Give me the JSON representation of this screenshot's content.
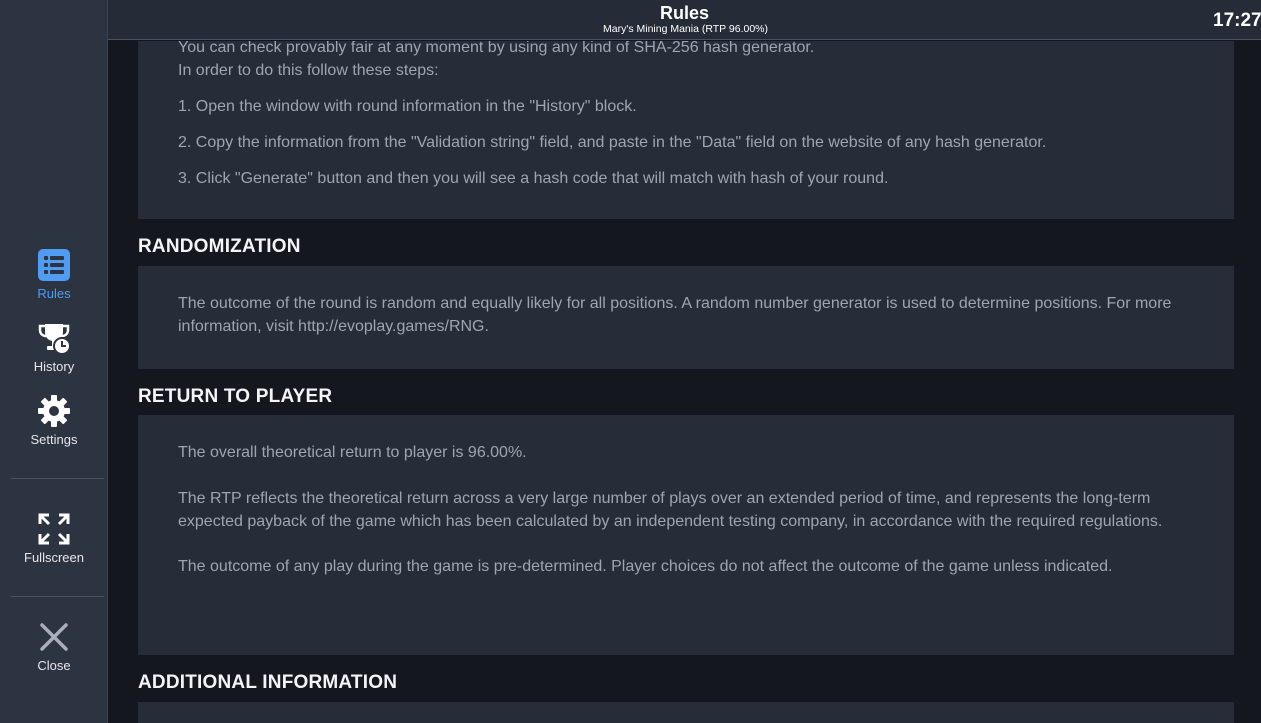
{
  "header": {
    "title": "Rules",
    "subtitle": "Mary's Mining Mania (RTP 96.00%)",
    "clock": "17:27"
  },
  "sidebar": {
    "items": [
      {
        "label": "Rules",
        "icon": "list-icon",
        "active": true
      },
      {
        "label": "History",
        "icon": "trophy-clock-icon"
      },
      {
        "label": "Settings",
        "icon": "gear-icon"
      },
      {
        "label": "Fullscreen",
        "icon": "fullscreen-icon"
      },
      {
        "label": "Close",
        "icon": "close-icon"
      }
    ]
  },
  "colors": {
    "accent": "#4f9cf0",
    "sidebar_bg": "#2d3441",
    "panel_bg": "#272d38",
    "page_bg": "#14171d"
  },
  "provably_fair": {
    "intro1": "You can check provably fair at any moment by using any kind of SHA-256 hash generator.",
    "intro2": "In order to do this follow these steps:",
    "step1": "1. Open the window with round information in the \"History\" block.",
    "step2": "2. Copy the information from the \"Validation string\" field, and paste in the \"Data\" field on the website of any hash generator.",
    "step3": "3. Click \"Generate\" button and then you will see a hash code that will match with hash of your round."
  },
  "randomization": {
    "heading": "RANDOMIZATION",
    "text": "The outcome of the round is random and equally likely for all positions. A random number generator is used to determine positions. For more information, visit http://evoplay.games/RNG."
  },
  "rtp": {
    "heading": "RETURN TO PLAYER",
    "p1": "The overall theoretical return to player is 96.00%.",
    "p2": "The RTP reflects the theoretical return across a very large number of plays over an extended period of time, and represents the long-term expected payback of the game which has been calculated by an independent testing company, in accordance with the required regulations.",
    "p3": "The outcome of any play during the game is pre-determined. Player choices do not affect the outcome of the game unless indicated."
  },
  "additional": {
    "heading": "ADDITIONAL INFORMATION"
  }
}
